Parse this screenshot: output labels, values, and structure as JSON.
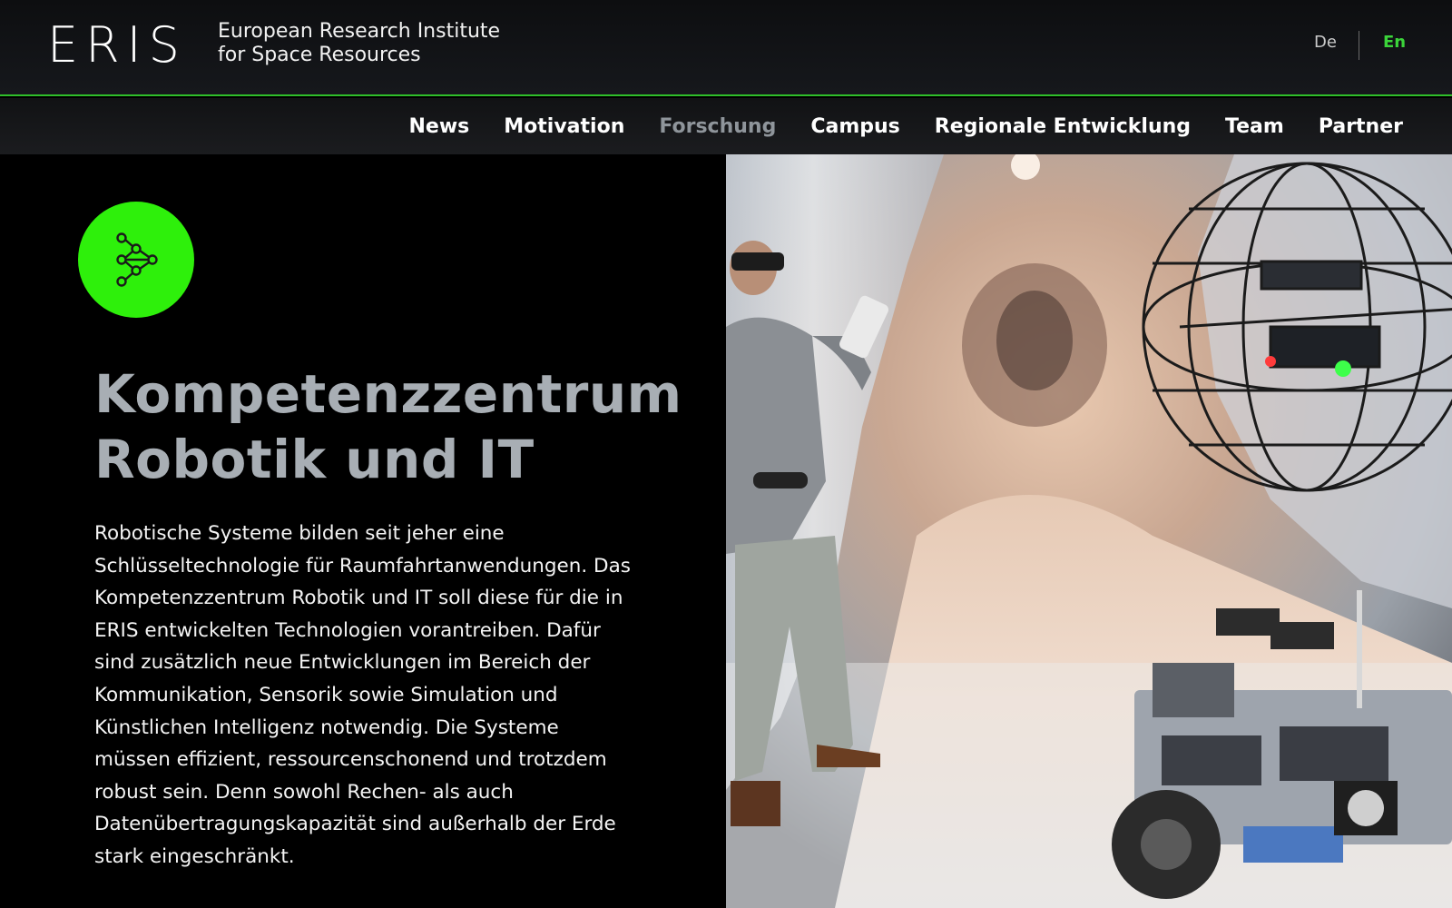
{
  "header": {
    "logo_text": "ERIS",
    "institute_line1": "European Research Institute",
    "institute_line2": "for Space Resources",
    "lang_de": "De",
    "lang_en": "En",
    "active_lang": "En",
    "accent_color": "#3bd43a"
  },
  "nav": {
    "items": [
      {
        "label": "News"
      },
      {
        "label": "Motivation"
      },
      {
        "label": "Forschung",
        "active": true
      },
      {
        "label": "Campus"
      },
      {
        "label": "Regionale Entwicklung"
      },
      {
        "label": "Team"
      },
      {
        "label": "Partner"
      }
    ]
  },
  "section": {
    "badge_icon": "network-nodes-icon",
    "badge_color": "#2ef00b",
    "title_line1": "Kompetenzzentrum",
    "title_line2": "Robotik und IT",
    "body_lines": [
      "Robotische Systeme bilden seit jeher eine",
      "Schlüsseltechnologie für Raumfahrtanwendungen. Das",
      "Kompetenzzentrum Robotik und IT soll diese für die in",
      "ERIS entwickelten Technologien vorantreiben. Dafür",
      "sind zusätzlich neue Entwicklungen im Bereich der",
      "Kommunikation, Sensorik sowie Simulation und",
      "Künstlichen Intelligenz notwendig. Die Systeme",
      "müssen effizient, ressourcenschonend und trotzdem",
      "robust sein. Denn sowohl Rechen- als auch",
      "Datenübertragungskapazität sind außerhalb der Erde",
      "stark eingeschränkt."
    ]
  }
}
